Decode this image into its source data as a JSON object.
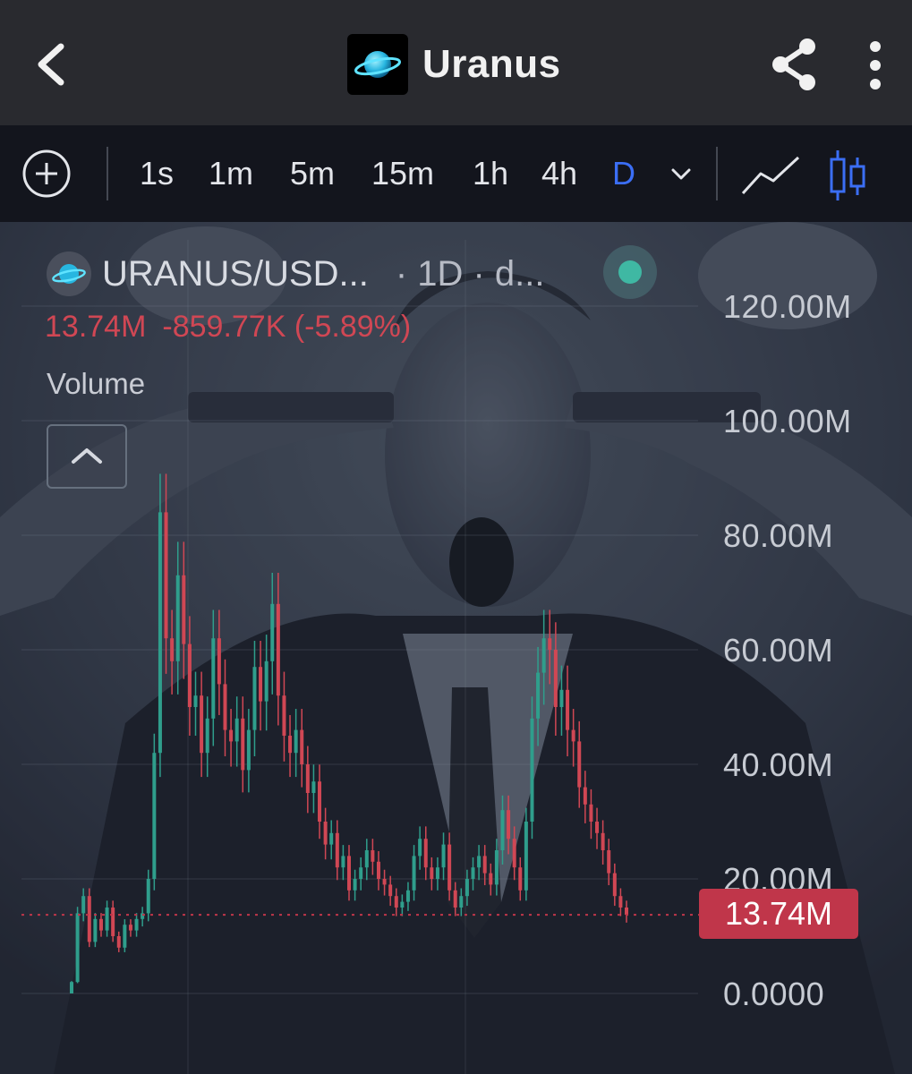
{
  "header": {
    "title": "Uranus",
    "icons": {
      "back": "back-arrow-icon",
      "share": "share-icon",
      "more": "more-vertical-icon",
      "logo": "uranus-planet-logo"
    }
  },
  "toolbar": {
    "timeframes": [
      "1s",
      "1m",
      "5m",
      "15m",
      "1h",
      "4h",
      "D"
    ],
    "active_timeframe": "D",
    "icons": {
      "add": "plus-circle-icon",
      "dropdown": "chevron-down-icon",
      "line": "line-chart-icon",
      "candles": "candlestick-icon"
    }
  },
  "chart": {
    "pair": "URANUS/USD...",
    "meta": "· 1D · d...",
    "last_value": "13.74M",
    "change": "-859.77K (-5.89%)",
    "study": "Volume",
    "price_tag": "13.74M",
    "y_axis_labels": [
      "120.00M",
      "100.00M",
      "80.00M",
      "60.00M",
      "40.00M",
      "20.00M",
      "0.0000"
    ],
    "colors": {
      "up": "#2f9e8c",
      "down": "#d04754",
      "tag": "#c0364a",
      "accent": "#3b6ef5"
    },
    "background_image": "meme photo of man in suit screaming with hands to head"
  },
  "chart_data": {
    "type": "line",
    "title": "",
    "xlabel": "",
    "ylabel": "",
    "ylim": [
      0,
      120000000
    ],
    "y_ticks": [
      0,
      20000000,
      40000000,
      60000000,
      80000000,
      100000000,
      120000000
    ],
    "last_value": 13740000,
    "grid": true,
    "series": [
      {
        "values": [
          2,
          14,
          17,
          9,
          13,
          11,
          15,
          10,
          8,
          12,
          11,
          13,
          14,
          20,
          42,
          84,
          62,
          58,
          73,
          61,
          50,
          52,
          42,
          48,
          62,
          54,
          46,
          44,
          48,
          39,
          46,
          57,
          51,
          58,
          68,
          52,
          45,
          42,
          46,
          40,
          35,
          37,
          30,
          26,
          28,
          22,
          24,
          18,
          20,
          22,
          25,
          23,
          20,
          19,
          17,
          15,
          16,
          18,
          24,
          27,
          22,
          20,
          22,
          26,
          18,
          15,
          17,
          20,
          22,
          24,
          21,
          19,
          25,
          32,
          27,
          22,
          18,
          30,
          48,
          56,
          62,
          60,
          50,
          53,
          46,
          44,
          36,
          33,
          30,
          28,
          25,
          21,
          17,
          15,
          13.74
        ]
      }
    ]
  }
}
